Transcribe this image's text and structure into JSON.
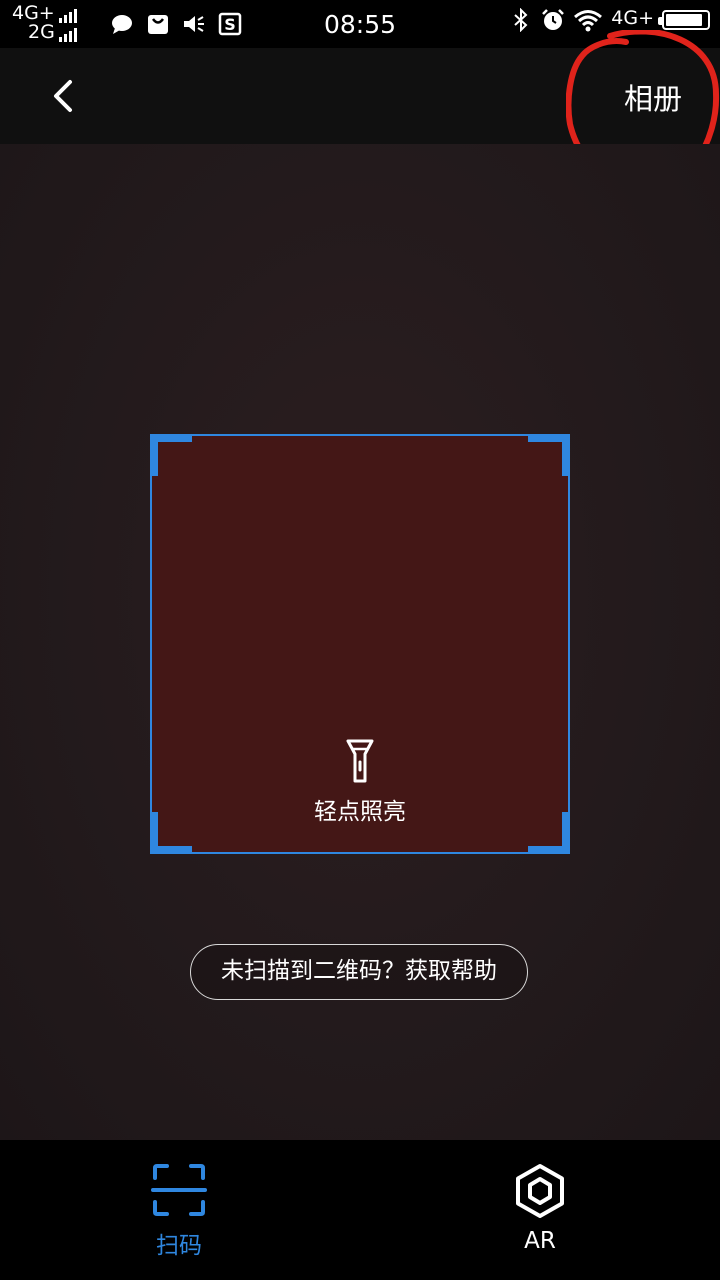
{
  "status_bar": {
    "network_1": "4G+",
    "network_2": "2G",
    "time": "08:55",
    "network_right": "4G+",
    "battery_level_percent": 90
  },
  "nav": {
    "album_label": "相册"
  },
  "scanner": {
    "flash_label": "轻点照亮",
    "help_text": "未扫描到二维码？获取帮助"
  },
  "tabs": [
    {
      "label": "扫码",
      "icon": "scan-frame-icon",
      "active": true
    },
    {
      "label": "AR",
      "icon": "ar-hexagon-icon",
      "active": false
    }
  ],
  "colors": {
    "accent": "#2f87e0",
    "annotation": "#e0231b"
  }
}
